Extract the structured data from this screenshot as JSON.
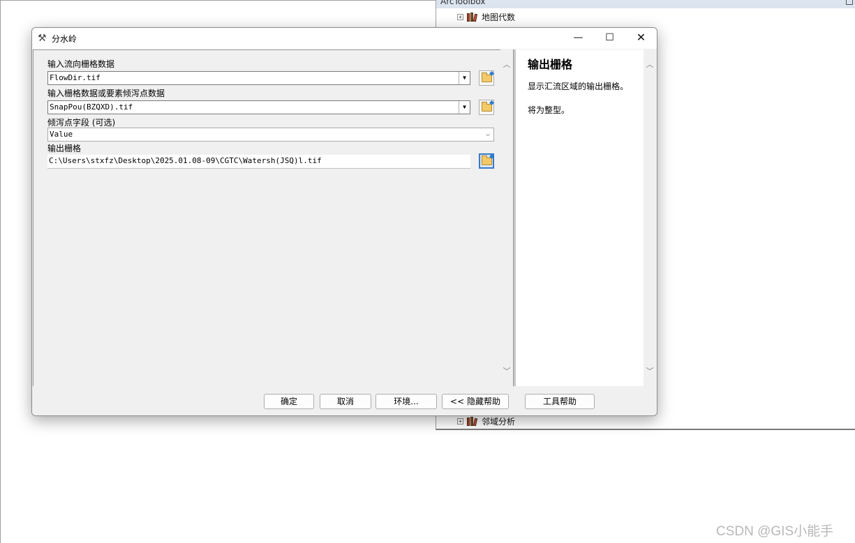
{
  "toolbox": {
    "title": "ArcToolbox",
    "items": [
      {
        "label": "地图代数"
      },
      {
        "label": "邻域分析"
      }
    ]
  },
  "dialog": {
    "title": "分水岭",
    "fields": {
      "flow_dir_label": "输入流向栅格数据",
      "flow_dir_value": "FlowDir.tif",
      "pour_label": "输入栅格数据或要素倾泻点数据",
      "pour_value": "SnapPou(BZQXD).tif",
      "pour_field_label": "倾泻点字段 (可选)",
      "pour_field_value": "Value",
      "output_label": "输出栅格",
      "output_value": "C:\\Users\\stxfz\\Desktop\\2025.01.08-09\\CGTC\\Watersh(JSQ)l.tif"
    },
    "help": {
      "title": "输出栅格",
      "line1": "显示汇流区域的输出栅格。",
      "line2": "将为整型。"
    },
    "buttons": {
      "ok": "确定",
      "cancel": "取消",
      "env": "环境...",
      "hide_help": "<< 隐藏帮助",
      "tool_help": "工具帮助"
    }
  },
  "watermark": "CSDN @GIS小能手"
}
